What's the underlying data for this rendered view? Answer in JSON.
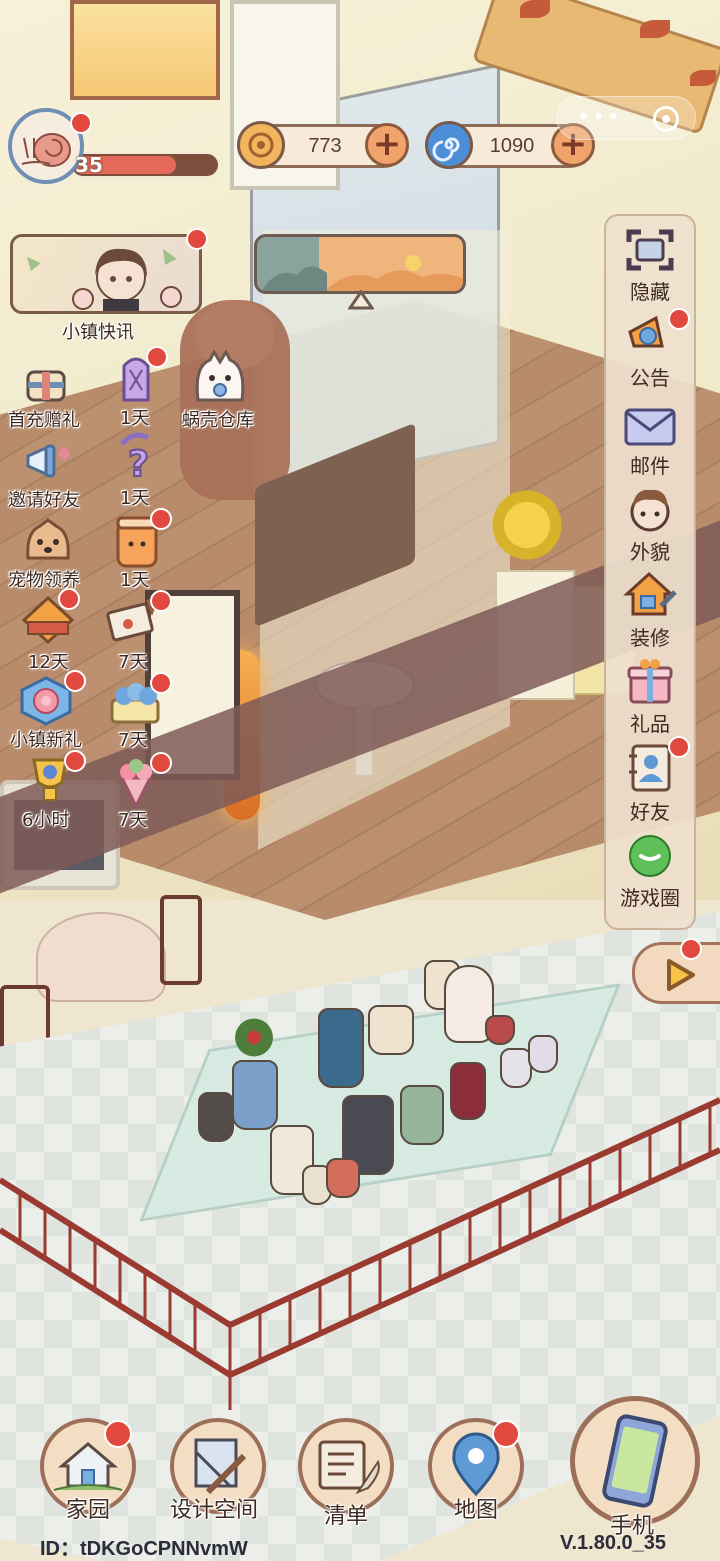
{
  "hud": {
    "level": "35",
    "level_progress": 0.72,
    "currencies": [
      {
        "name": "coin",
        "value": "773",
        "color": "#f2b45c"
      },
      {
        "name": "shell",
        "value": "1090",
        "color": "#4d8ed8"
      }
    ]
  },
  "left_menu": {
    "news": "小镇快讯",
    "items": [
      {
        "id": "first-charge",
        "label": "首充赠礼",
        "icon": "gift-scroll-icon"
      },
      {
        "id": "snail-warehouse",
        "label": "蜗壳仓库",
        "icon": "cat-mascot-icon"
      },
      {
        "id": "invite",
        "label": "邀请好友",
        "icon": "megaphone-icon"
      },
      {
        "id": "pet",
        "label": "宠物领养",
        "icon": "dog-icon"
      },
      {
        "id": "town-gift",
        "label": "小镇新礼",
        "icon": "flower-badge-icon"
      }
    ],
    "timers": [
      {
        "id": "timer-1",
        "label": "1天"
      },
      {
        "id": "timer-2",
        "label": "1天"
      },
      {
        "id": "timer-3",
        "label": "1天"
      },
      {
        "id": "timer-4",
        "label": "12天"
      },
      {
        "id": "timer-5",
        "label": "7天"
      },
      {
        "id": "timer-6",
        "label": "7天"
      },
      {
        "id": "timer-7",
        "label": "6小时"
      },
      {
        "id": "timer-8",
        "label": "7天"
      }
    ]
  },
  "right_menu": [
    {
      "id": "hide",
      "label": "隐藏",
      "icon": "frame-corners-icon"
    },
    {
      "id": "notice",
      "label": "公告",
      "icon": "megaphone-icon"
    },
    {
      "id": "mail",
      "label": "邮件",
      "icon": "envelope-icon"
    },
    {
      "id": "appearance",
      "label": "外貌",
      "icon": "character-face-icon"
    },
    {
      "id": "decorate",
      "label": "装修",
      "icon": "house-wrench-icon"
    },
    {
      "id": "gifts",
      "label": "礼品",
      "icon": "gift-box-icon"
    },
    {
      "id": "friends",
      "label": "好友",
      "icon": "contact-book-icon"
    },
    {
      "id": "game-circle",
      "label": "游戏圈",
      "icon": "chat-bubble-icon"
    }
  ],
  "bottom_nav": [
    {
      "id": "home",
      "label": "家园",
      "icon": "house-icon"
    },
    {
      "id": "design",
      "label": "设计空间",
      "icon": "ruler-pencil-icon"
    },
    {
      "id": "list",
      "label": "清单",
      "icon": "scroll-quill-icon"
    },
    {
      "id": "map",
      "label": "地图",
      "icon": "map-pin-icon"
    },
    {
      "id": "phone",
      "label": "手机",
      "icon": "smartphone-icon"
    }
  ],
  "footer": {
    "id_text": "ID：tDKGoCPNNvmW",
    "version": "V.1.80.0_35"
  },
  "colors": {
    "badge": "#e2493e",
    "panel_border": "#9d6f58",
    "text": "#3e2a22"
  }
}
